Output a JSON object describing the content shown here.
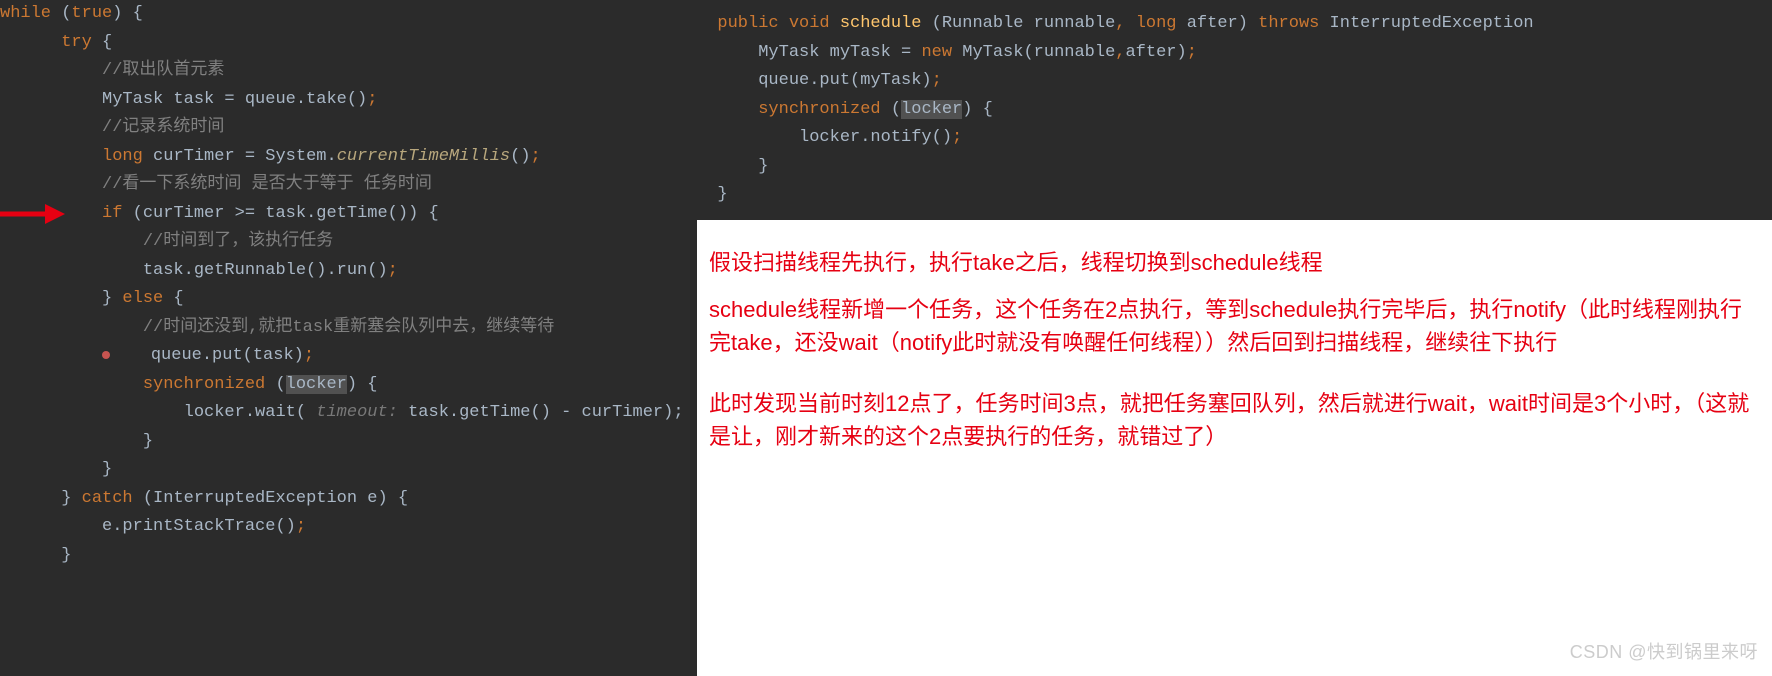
{
  "left_code": {
    "l0a": "  ",
    "l0b": "while",
    "l0c": " (",
    "l0d": "true",
    "l0e": ") {",
    "l1a": "      ",
    "l1b": "try",
    "l1c": " {",
    "l2": "          //取出队首元素",
    "l3a": "          MyTask task = queue.take()",
    "l3b": ";",
    "l4": "          //记录系统时间",
    "l5a": "          ",
    "l5b": "long",
    "l5c": " curTimer = System.",
    "l5d": "currentTimeMillis",
    "l5e": "()",
    "l5f": ";",
    "l6": "          //看一下系统时间 是否大于等于 任务时间",
    "l7a": "          ",
    "l7b": "if",
    "l7c": " (curTimer >= task.getTime()) {",
    "l8": "              //时间到了，该执行任务",
    "l9a": "              task.getRunnable().run()",
    "l9b": ";",
    "l10a": "          } ",
    "l10b": "else",
    "l10c": " {",
    "l11": "              //时间还没到,就把task重新塞会队列中去，继续等待",
    "l12pad": "          ",
    "l12a": "    queue.put(task)",
    "l12b": ";",
    "l13a": "              ",
    "l13b": "synchronized",
    "l13c": " (",
    "l13d": "locker",
    "l13e": ") {",
    "l14a": "                  locker.wait( ",
    "l14h": "timeout:",
    "l14b": " task.getTime() - curTimer);",
    "l15": "              }",
    "l16": "          }",
    "l17a": "      } ",
    "l17b": "catch",
    "l17c": " (InterruptedException e) {",
    "l18a": "          e.printStackTrace()",
    "l18b": ";",
    "l19": "      }"
  },
  "right_code": {
    "r0a": "  ",
    "r0b": "public void ",
    "r0c": "schedule",
    "r0d": " (Runnable runnable",
    "r0e": ", ",
    "r0f": "long",
    "r0g": " after) ",
    "r0h": "throws",
    "r0i": " InterruptedException ",
    "r1a": "      MyTask myTask = ",
    "r1b": "new",
    "r1c": " MyTask(runnable",
    "r1d": ",",
    "r1e": "after)",
    "r1f": ";",
    "r2a": "      queue.put(myTask)",
    "r2b": ";",
    "r3a": "      ",
    "r3b": "synchronized",
    "r3c": " (",
    "r3d": "locker",
    "r3e": ") {",
    "r4a": "          locker.notify()",
    "r4b": ";",
    "r5": "      }",
    "r6": "  }"
  },
  "explanation": {
    "p1": "假设扫描线程先执行，执行take之后，线程切换到schedule线程",
    "p2": "schedule线程新增一个任务，这个任务在2点执行，等到schedule执行完毕后，执行notify（此时线程刚执行完take，还没wait（notify此时就没有唤醒任何线程））然后回到扫描线程，继续往下执行",
    "p3": "此时发现当前时刻12点了，任务时间3点，就把任务塞回队列，然后就进行wait，wait时间是3个小时，（这就是让，刚才新来的这个2点要执行的任务，就错过了）"
  },
  "watermark": "CSDN @快到锅里来呀"
}
